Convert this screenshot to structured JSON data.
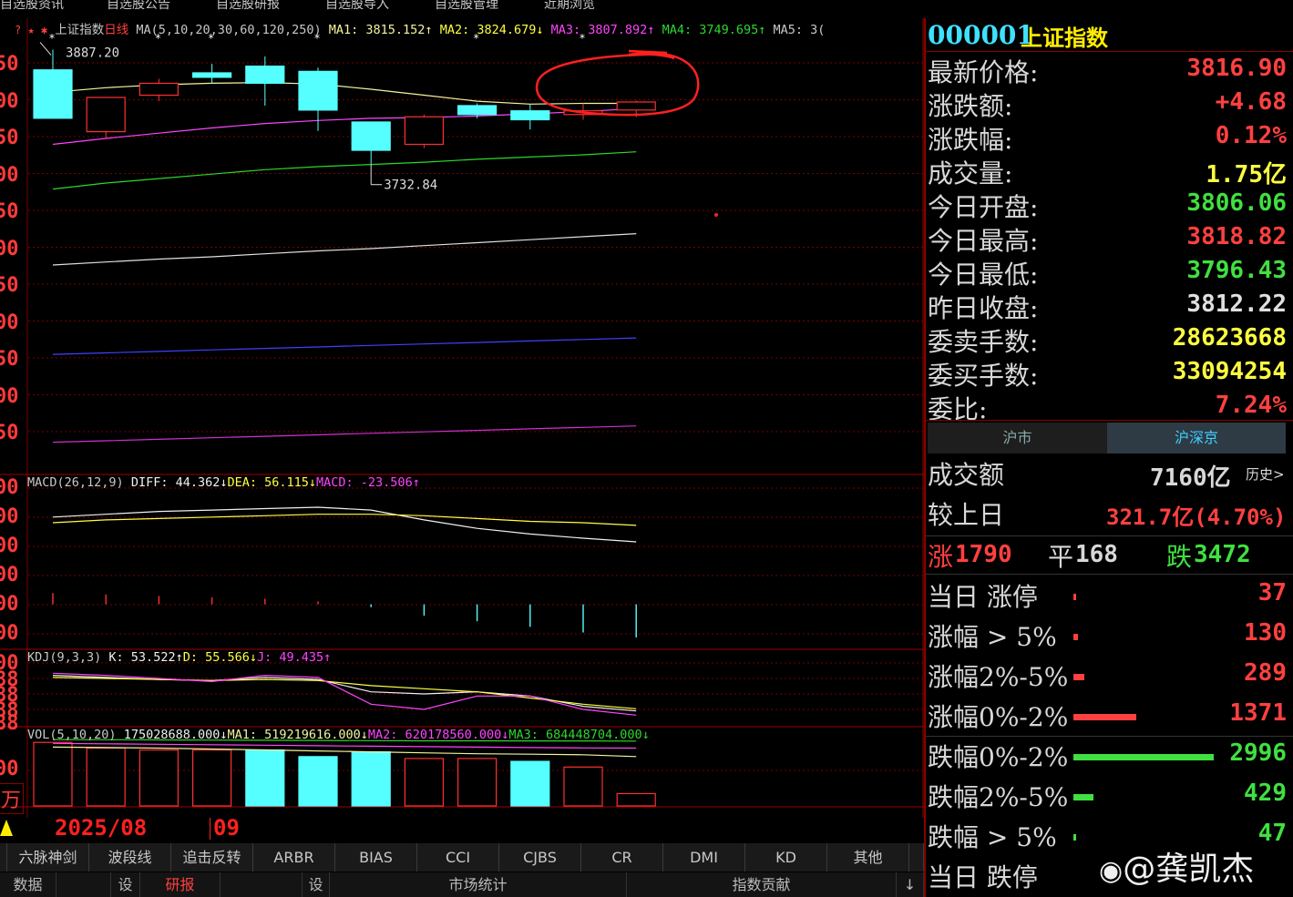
{
  "nav": [
    "自选股资讯",
    "自选股公告",
    "自选股研报",
    "自选股导入",
    "自选股管理",
    "近期浏览"
  ],
  "chart": {
    "title_icons": "? ★ ✱",
    "title": "上证指数",
    "period": "日线",
    "ma_legend": {
      "prefix": "MA(5,10,20,30,60,120,250)",
      "ma1": "MA1: 3815.152↑",
      "ma2": "MA2: 3824.679↓",
      "ma3": "MA3: 3807.892↑",
      "ma4": "MA4: 3749.695↑",
      "ma5": "MA5: 3("
    },
    "high_label": "3887.20",
    "low_label": "3732.84",
    "price_axis_labels": [
      "50",
      "00",
      "50",
      "00",
      "50",
      "00",
      "50",
      "00",
      "50",
      "00",
      "50"
    ],
    "macd_legend": {
      "prefix": "MACD(26,12,9)",
      "diff": "DIFF: 44.362↓",
      "dea": "DEA: 56.115↓",
      "macd": "MACD: -23.506↑"
    },
    "macd_axis_labels": [
      "00",
      "00",
      "00",
      "00",
      "00",
      "00"
    ],
    "kdj_legend": {
      "prefix": "KDJ(9,3,3)",
      "k": "K: 53.522↑",
      "d": "D: 55.566↓",
      "j": "J: 49.435↑"
    },
    "kdj_axis_labels": [
      "00",
      "88",
      "88",
      "88",
      "88"
    ],
    "vol_legend": {
      "prefix": "VOL(5,10,20)",
      "vol": "175028688.000↓",
      "ma1": "MA1: 519219616.000↓",
      "ma2": "MA2: 620178560.000↓",
      "ma3": "MA3: 684448704.000↓"
    },
    "vol_axis_labels": [
      "00",
      "万"
    ],
    "dates": {
      "month1": "2025/08",
      "month2": "09"
    },
    "candles": [
      {
        "o": 3860,
        "c": 3795,
        "h": 3887.2,
        "l": 3795,
        "star": true
      },
      {
        "o": 3777,
        "c": 3823,
        "h": 3823,
        "l": 3768,
        "star": false
      },
      {
        "o": 3826,
        "c": 3842,
        "h": 3848,
        "l": 3818,
        "star": true
      },
      {
        "o": 3856,
        "c": 3850,
        "h": 3868,
        "l": 3842,
        "star": true
      },
      {
        "o": 3865,
        "c": 3842,
        "h": 3878,
        "l": 3812,
        "star": false
      },
      {
        "o": 3858,
        "c": 3806,
        "h": 3863,
        "l": 3778,
        "star": true
      },
      {
        "o": 3790,
        "c": 3752,
        "h": 3790,
        "l": 3732.84,
        "star": false
      },
      {
        "o": 3760,
        "c": 3797,
        "h": 3800,
        "l": 3755,
        "star": false
      },
      {
        "o": 3812,
        "c": 3800,
        "h": 3815,
        "l": 3795,
        "star": true
      },
      {
        "o": 3805,
        "c": 3793,
        "h": 3814,
        "l": 3780,
        "star": false
      },
      {
        "o": 3800,
        "c": 3805,
        "h": 3815,
        "l": 3793,
        "star": true
      },
      {
        "o": 3806.06,
        "c": 3816.9,
        "h": 3818.82,
        "l": 3796.43,
        "star": false
      }
    ],
    "ma_series": [
      {
        "color": "#f4f4a0",
        "values": [
          3830,
          3836,
          3840,
          3842,
          3843,
          3841,
          3834,
          3826,
          3818,
          3814,
          3815,
          3815
        ]
      },
      {
        "color": "#ff44ff",
        "values": [
          3760,
          3768,
          3775,
          3782,
          3788,
          3792,
          3795,
          3796,
          3798,
          3801,
          3804,
          3808
        ]
      },
      {
        "color": "#2bd82b",
        "values": [
          3700,
          3708,
          3714,
          3720,
          3726,
          3730,
          3733,
          3736,
          3740,
          3743,
          3746,
          3750
        ]
      },
      {
        "color": "#e0e0e0",
        "values": [
          3598,
          3602,
          3606,
          3609,
          3613,
          3617,
          3620,
          3624,
          3628,
          3632,
          3636,
          3640
        ]
      },
      {
        "color": "#4040ff",
        "values": [
          3478,
          3480,
          3482,
          3484,
          3486,
          3488,
          3490,
          3492,
          3494,
          3496,
          3498,
          3500
        ]
      },
      {
        "color": "#d030d0",
        "values": [
          3360,
          3362,
          3364,
          3366,
          3368,
          3370,
          3372,
          3374,
          3376,
          3378,
          3380,
          3382
        ]
      }
    ],
    "macd": {
      "diff": [
        62,
        64,
        66,
        67,
        68,
        69,
        67,
        60,
        54,
        50,
        47,
        44.4
      ],
      "dea": [
        58,
        60,
        61,
        62,
        63,
        64,
        64,
        63,
        61,
        59,
        58,
        56.1
      ],
      "bars": [
        8,
        7,
        6,
        5,
        4,
        2,
        -2,
        -8,
        -12,
        -16,
        -20,
        -23.5
      ]
    },
    "kdj": {
      "k": [
        88,
        86,
        84,
        83,
        86,
        84,
        72,
        70,
        72,
        68,
        58,
        53.5
      ],
      "d": [
        86,
        85,
        84,
        83,
        84,
        83,
        78,
        75,
        72,
        66,
        60,
        55.6
      ],
      "j": [
        90,
        88,
        85,
        82,
        88,
        86,
        60,
        55,
        68,
        68,
        55,
        49.4
      ]
    },
    "volume": [
      {
        "v": 670,
        "up": false
      },
      {
        "v": 610,
        "up": false
      },
      {
        "v": 590,
        "up": false
      },
      {
        "v": 590,
        "up": false
      },
      {
        "v": 590,
        "up": true
      },
      {
        "v": 520,
        "up": true
      },
      {
        "v": 570,
        "up": true
      },
      {
        "v": 500,
        "up": false
      },
      {
        "v": 500,
        "up": false
      },
      {
        "v": 470,
        "up": true
      },
      {
        "v": 410,
        "up": false
      },
      {
        "v": 130,
        "up": false
      }
    ],
    "vol_ma": {
      "ma1": [
        620,
        615,
        610,
        600,
        590,
        580,
        570,
        560,
        550,
        545,
        540,
        520
      ],
      "ma2": [
        660,
        655,
        650,
        645,
        640,
        635,
        630,
        625,
        620,
        615,
        612,
        610
      ],
      "ma3": [
        700,
        698,
        696,
        694,
        692,
        690,
        688,
        686,
        686,
        685,
        685,
        684
      ]
    }
  },
  "tabs": [
    "六脉神剑",
    "波段线",
    "追击反转",
    "ARBR",
    "BIAS",
    "CCI",
    "CJBS",
    "CR",
    "DMI",
    "KD",
    "其他"
  ],
  "bottom_tabs": [
    "数据",
    "设",
    "研报",
    "设",
    "市场统计",
    "指数贡献",
    "↓"
  ],
  "panel": {
    "code": "000001",
    "name": "上证指数",
    "quotes": [
      {
        "label": "最新价格:",
        "value": "3816.90",
        "color": "#ff4040"
      },
      {
        "label": "涨跌额:",
        "value": "+4.68",
        "color": "#ff4040"
      },
      {
        "label": "涨跌幅:",
        "value": "0.12%",
        "color": "#ff4040"
      },
      {
        "label": "成交量:",
        "value": "1.75亿",
        "color": "#ffff40"
      },
      {
        "label": "今日开盘:",
        "value": "3806.06",
        "color": "#40e040"
      },
      {
        "label": "今日最高:",
        "value": "3818.82",
        "color": "#ff4040"
      },
      {
        "label": "今日最低:",
        "value": "3796.43",
        "color": "#40e040"
      },
      {
        "label": "昨日收盘:",
        "value": "3812.22",
        "color": "#e0e0e0"
      },
      {
        "label": "委卖手数:",
        "value": "28623668",
        "color": "#ffff40"
      },
      {
        "label": "委买手数:",
        "value": "33094254",
        "color": "#ffff40"
      },
      {
        "label": "委比:",
        "value": "7.24%",
        "color": "#ff4040"
      }
    ],
    "market_tabs": [
      "沪市",
      "沪深京"
    ],
    "turnover_label": "成交额",
    "turnover_value": "7160亿",
    "history_label": "历史>",
    "vs_prev_label": "较上日",
    "vs_prev_value": "321.7亿(4.70%)",
    "breadth": {
      "up_label": "涨",
      "up": "1790",
      "flat_label": "平",
      "flat": "168",
      "down_label": "跌",
      "down": "3472"
    },
    "distribution": [
      {
        "label": "当日 涨停",
        "count": "37",
        "fraction": 0.01,
        "color": "#ff4040"
      },
      {
        "label": "涨幅 > 5%",
        "count": "130",
        "fraction": 0.03,
        "color": "#ff4040"
      },
      {
        "label": "涨幅2%-5%",
        "count": "289",
        "fraction": 0.08,
        "color": "#ff4040"
      },
      {
        "label": "涨幅0%-2%",
        "count": "1371",
        "fraction": 0.45,
        "color": "#ff4040"
      },
      {
        "label": "跌幅0%-2%",
        "count": "2996",
        "fraction": 1.0,
        "color": "#40e040"
      },
      {
        "label": "跌幅2%-5%",
        "count": "429",
        "fraction": 0.14,
        "color": "#40e040"
      },
      {
        "label": "跌幅 > 5%",
        "count": "47",
        "fraction": 0.01,
        "color": "#40e040"
      },
      {
        "label": "当日 跌停",
        "count": "",
        "fraction": 0,
        "color": "#40e040"
      }
    ],
    "watermark": "@龚凯杰"
  },
  "colors": {
    "up": "#ff3030",
    "down": "#55ffff",
    "grid": "#7a0000",
    "circle": "#ff2020"
  }
}
